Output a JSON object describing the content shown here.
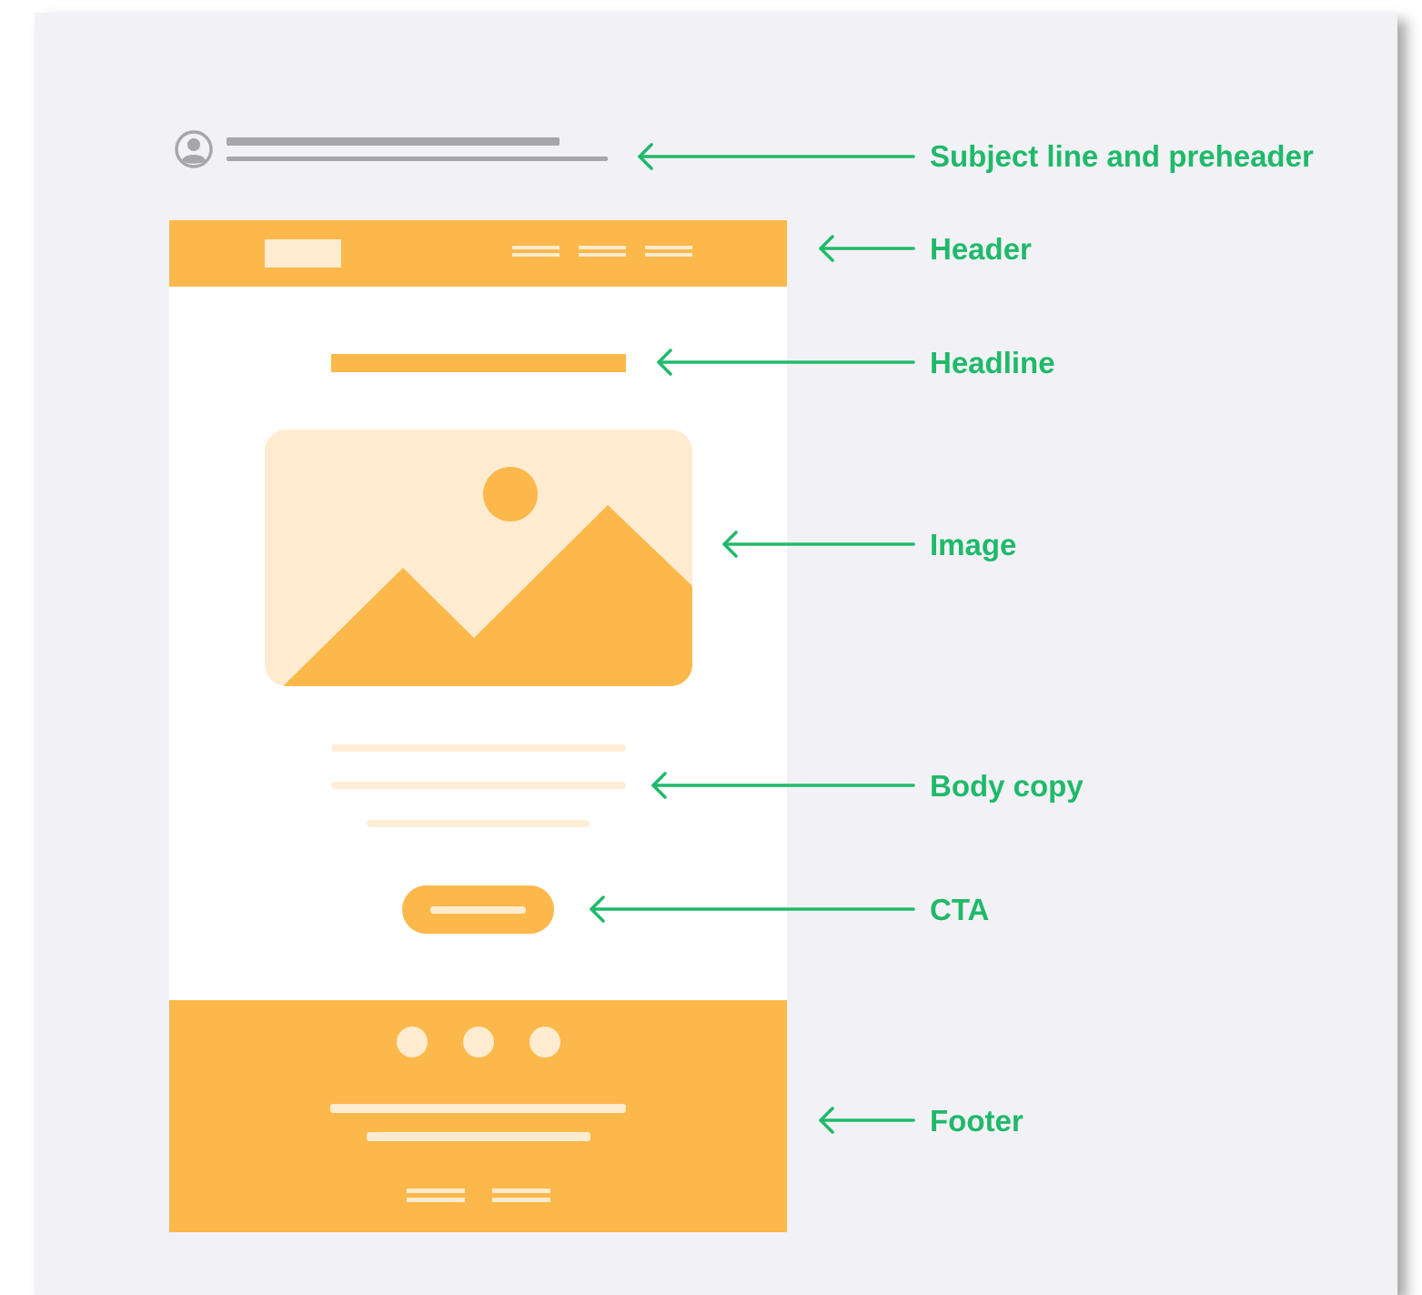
{
  "colors": {
    "accent": "#fcb84b",
    "accent_light": "#ffecd0",
    "annotation": "#20b96a",
    "placeholder_gray": "#a7a7ab"
  },
  "annotations": [
    {
      "id": "subject",
      "label": "Subject line and preheader"
    },
    {
      "id": "header",
      "label": "Header"
    },
    {
      "id": "headline",
      "label": "Headline"
    },
    {
      "id": "image",
      "label": "Image"
    },
    {
      "id": "body",
      "label": "Body copy"
    },
    {
      "id": "cta",
      "label": "CTA"
    },
    {
      "id": "footer",
      "label": "Footer"
    }
  ],
  "icons": {
    "avatar": "user-avatar-icon",
    "image": "mountain-sun-image-icon",
    "arrow": "arrow-left-icon"
  }
}
